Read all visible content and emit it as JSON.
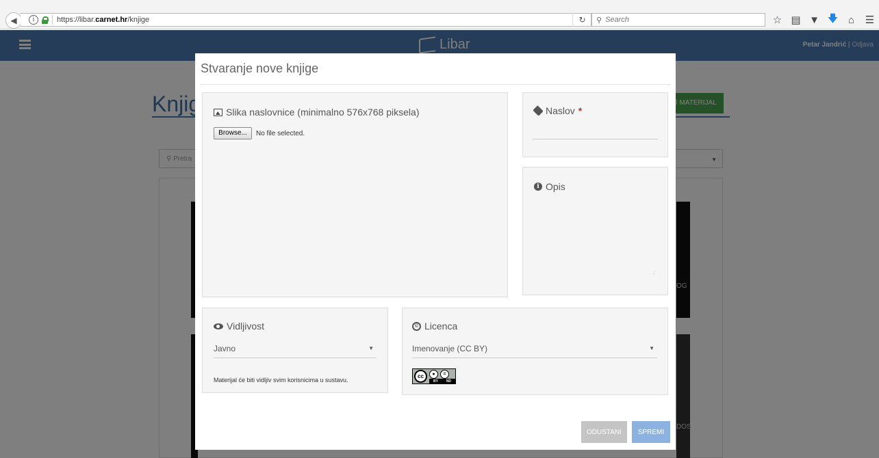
{
  "browser": {
    "url_scheme": "https://libar.",
    "url_host": "carnet.hr",
    "url_path": "/knjige",
    "search_placeholder": "Search"
  },
  "app": {
    "brand": "Libar",
    "user_name": "Petar Jandrić",
    "separator": "|",
    "logout": "Odjava",
    "page_title": "Knjig",
    "add_material": "AJ MATERIJAL",
    "search_placeholder": "Pretra",
    "cover_labels": [
      "OG",
      "DOS"
    ]
  },
  "modal": {
    "title": "Stvaranje nove knjige",
    "cover_image": {
      "label": "Slika naslovnice (minimalno 576x768 piksela)",
      "browse_label": "Browse...",
      "file_status": "No file selected."
    },
    "title_field": {
      "label": "Naslov",
      "required_mark": "*",
      "value": ""
    },
    "description_field": {
      "label": "Opis",
      "value": ""
    },
    "visibility": {
      "label": "Vidljivost",
      "selected": "Javno",
      "help": "Materijal će biti vidljiv svim korisnicima u sustavu."
    },
    "license": {
      "label": "Licenca",
      "selected": "Imenovanje (CC BY)",
      "badge_logo": "cc",
      "badge_text_left": "BY",
      "badge_text_right": "ND"
    },
    "buttons": {
      "cancel": "ODUSTANI",
      "save": "SPREMI"
    }
  },
  "colors": {
    "navbar": "#4a7bb0",
    "add_material": "#49a34e",
    "cancel_button": "#c4c4c4",
    "save_button": "#8cb3df",
    "required": "#c9302c"
  }
}
